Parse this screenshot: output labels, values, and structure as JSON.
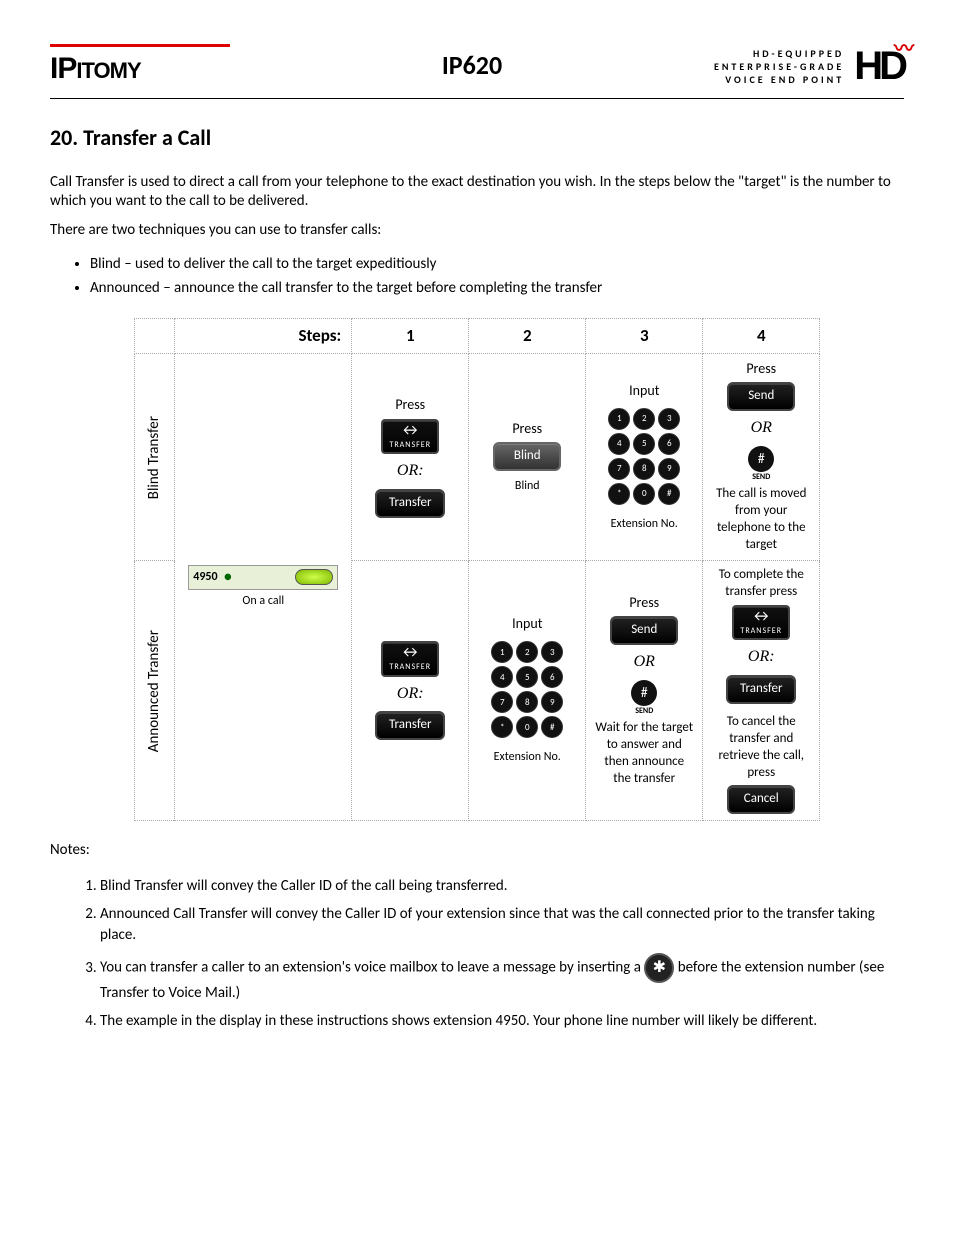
{
  "header": {
    "logo_main": "IP",
    "logo_sub": "ITOMY",
    "center": "IP620",
    "right_line1": "HD-EQUIPPED",
    "right_line2": "ENTERPRISE-GRADE",
    "right_line3": "VOICE END POINT",
    "hd": "HD"
  },
  "title": "20. Transfer a Call",
  "intro1": "Call Transfer is used to direct a call from your telephone to the exact destination you wish. In the steps below the \"target\" is the number to which you want to the call to be delivered.",
  "intro2": "There are two techniques you can use to transfer calls:",
  "bullets": {
    "b1": "Blind – used to deliver the call to the target expeditiously",
    "b2": "Announced – announce the call transfer to the target before completing the transfer"
  },
  "table": {
    "steps_label": "Steps:",
    "col1": "1",
    "col2": "2",
    "col3": "3",
    "col4": "4",
    "row1_label": "Blind Transfer",
    "row2_label": "Announced Transfer",
    "on_call_ext": "4950",
    "on_call_caption": "On a call",
    "press": "Press",
    "input": "Input",
    "or": "OR:",
    "or_plain": "OR",
    "btn_transfer_hard": "TRANSFER",
    "btn_transfer_soft": "Transfer",
    "btn_blind": "Blind",
    "blind_caption": "Blind",
    "ext_caption": "Extension No.",
    "btn_send": "Send",
    "hash_sub": "SEND",
    "r1c4_text": "The call is moved from your telephone to the target",
    "r2c3_text": "Wait for the target to answer and then announce the transfer",
    "r2c4_text1": "To complete the transfer press",
    "r2c4_text2": "To cancel the transfer and retrieve the call, press",
    "btn_cancel": "Cancel",
    "keys": [
      "1",
      "2",
      "3",
      "4",
      "5",
      "6",
      "7",
      "8",
      "9",
      "*",
      "0",
      "#"
    ]
  },
  "notes_label": "Notes:",
  "notes": {
    "n1": "Blind Transfer will convey the Caller ID of the call being transferred.",
    "n2": "Announced Call Transfer will convey the Caller ID of your extension since that was the call connected prior to the transfer taking place.",
    "n3a": "You can transfer a caller to an extension's voice mailbox to leave a message by inserting a ",
    "n3b": " before the extension number (see Transfer to Voice Mail.)",
    "n4": "The example in the display in these instructions shows extension 4950. Your phone line number will likely be different."
  }
}
